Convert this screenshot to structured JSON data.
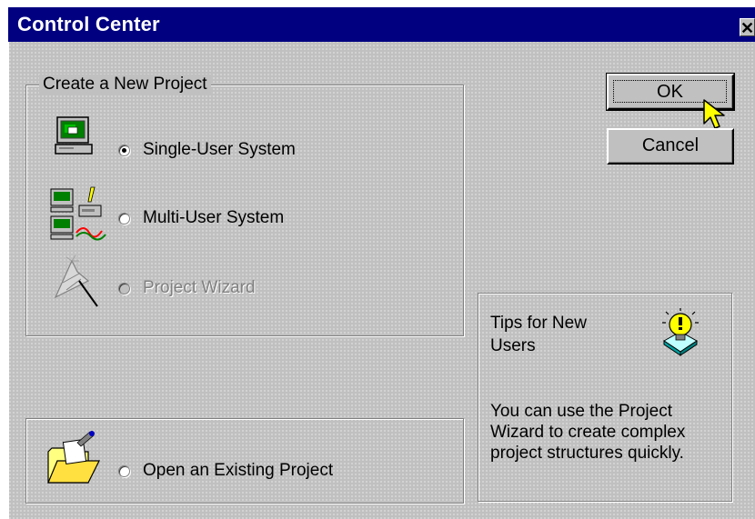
{
  "window": {
    "title": "Control Center",
    "close_label": "✕"
  },
  "create_group": {
    "legend": "Create a New Project",
    "options": [
      {
        "label": "Single-User System",
        "checked": true,
        "enabled": true,
        "icon": "computer-icon"
      },
      {
        "label": "Multi-User System",
        "checked": false,
        "enabled": true,
        "icon": "network-computers-icon"
      },
      {
        "label": "Project Wizard",
        "checked": false,
        "enabled": false,
        "icon": "wizard-wand-icon"
      }
    ]
  },
  "open_group": {
    "label": "Open an Existing Project",
    "checked": false,
    "icon": "open-folder-icon"
  },
  "buttons": {
    "ok_label": "OK",
    "cancel_label": "Cancel"
  },
  "tips": {
    "title": "Tips for New Users",
    "body": "You can use the Project Wizard to create complex project structures quickly.",
    "icon": "lightbulb-icon"
  },
  "colors": {
    "titlebar": "#000080",
    "face": "#c0c0c0",
    "disabled_text": "#808080"
  }
}
